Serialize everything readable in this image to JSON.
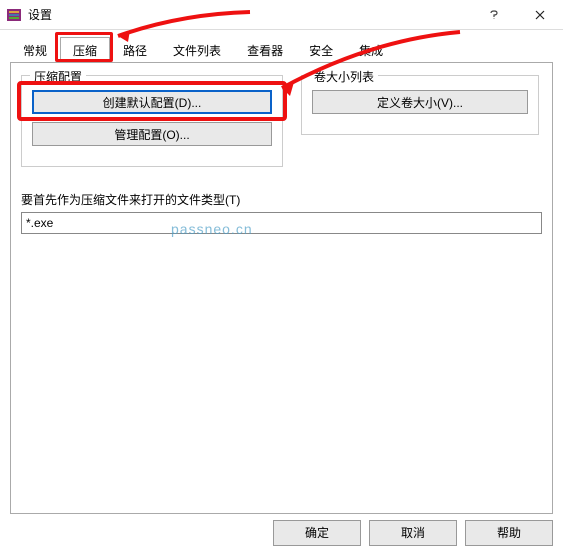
{
  "titlebar": {
    "title": "设置"
  },
  "tabs": [
    "常规",
    "压缩",
    "路径",
    "文件列表",
    "查看器",
    "安全",
    "集成"
  ],
  "selected_tab_index": 1,
  "group_compress": {
    "legend": "压缩配置",
    "btn_create": "创建默认配置(D)...",
    "btn_manage": "管理配置(O)..."
  },
  "group_volume": {
    "legend": "卷大小列表",
    "btn_define": "定义卷大小(V)..."
  },
  "filetype_label": "要首先作为压缩文件来打开的文件类型(T)",
  "filetype_value": "*.exe",
  "buttons": {
    "ok": "确定",
    "cancel": "取消",
    "help": "帮助"
  },
  "watermark": "passneo.cn"
}
